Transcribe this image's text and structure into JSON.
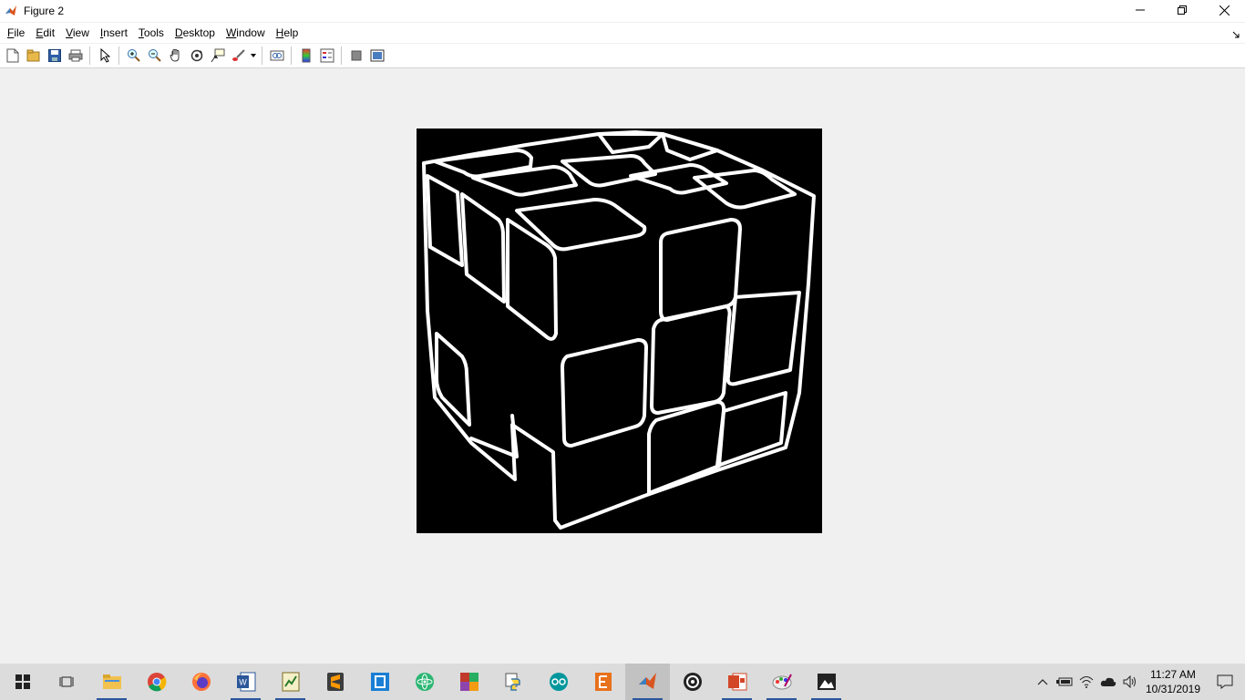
{
  "window": {
    "title": "Figure 2"
  },
  "menu": {
    "items": [
      {
        "label": "File",
        "accel": "F"
      },
      {
        "label": "Edit",
        "accel": "E"
      },
      {
        "label": "View",
        "accel": "V"
      },
      {
        "label": "Insert",
        "accel": "I"
      },
      {
        "label": "Tools",
        "accel": "T"
      },
      {
        "label": "Desktop",
        "accel": "D"
      },
      {
        "label": "Window",
        "accel": "W"
      },
      {
        "label": "Help",
        "accel": "H"
      }
    ]
  },
  "toolbar": {
    "buttons": [
      "new-figure-icon",
      "open-file-icon",
      "save-icon",
      "print-icon",
      "edit-plot-icon",
      "zoom-in-icon",
      "zoom-out-icon",
      "pan-icon",
      "rotate-3d-icon",
      "data-cursor-icon",
      "brush-icon",
      "link-plot-icon",
      "colorbar-icon",
      "legend-icon",
      "hide-plot-tools-icon",
      "show-plot-tools-icon"
    ]
  },
  "figure": {
    "content": "binary edge-detected image of a cube, white edges on black background",
    "background_color": "#000000",
    "edge_color": "#ffffff"
  },
  "taskbar": {
    "apps": [
      "start-icon",
      "task-view-icon",
      "file-explorer-icon",
      "chrome-icon",
      "firefox-icon",
      "word-icon",
      "sheets-icon",
      "sublime-icon",
      "notepad-icon",
      "atom-icon",
      "winrar-icon",
      "python-icon",
      "arduino-icon",
      "editor-icon",
      "matlab-icon",
      "obs-icon",
      "ppt-icon",
      "paint-icon",
      "photos-icon"
    ],
    "clock": {
      "time": "11:27 AM",
      "date": "10/31/2019"
    }
  },
  "colors": {
    "accent": "#2b579a",
    "taskbar_bg": "#dcdcdc",
    "figure_bg": "#f0f0f0"
  }
}
